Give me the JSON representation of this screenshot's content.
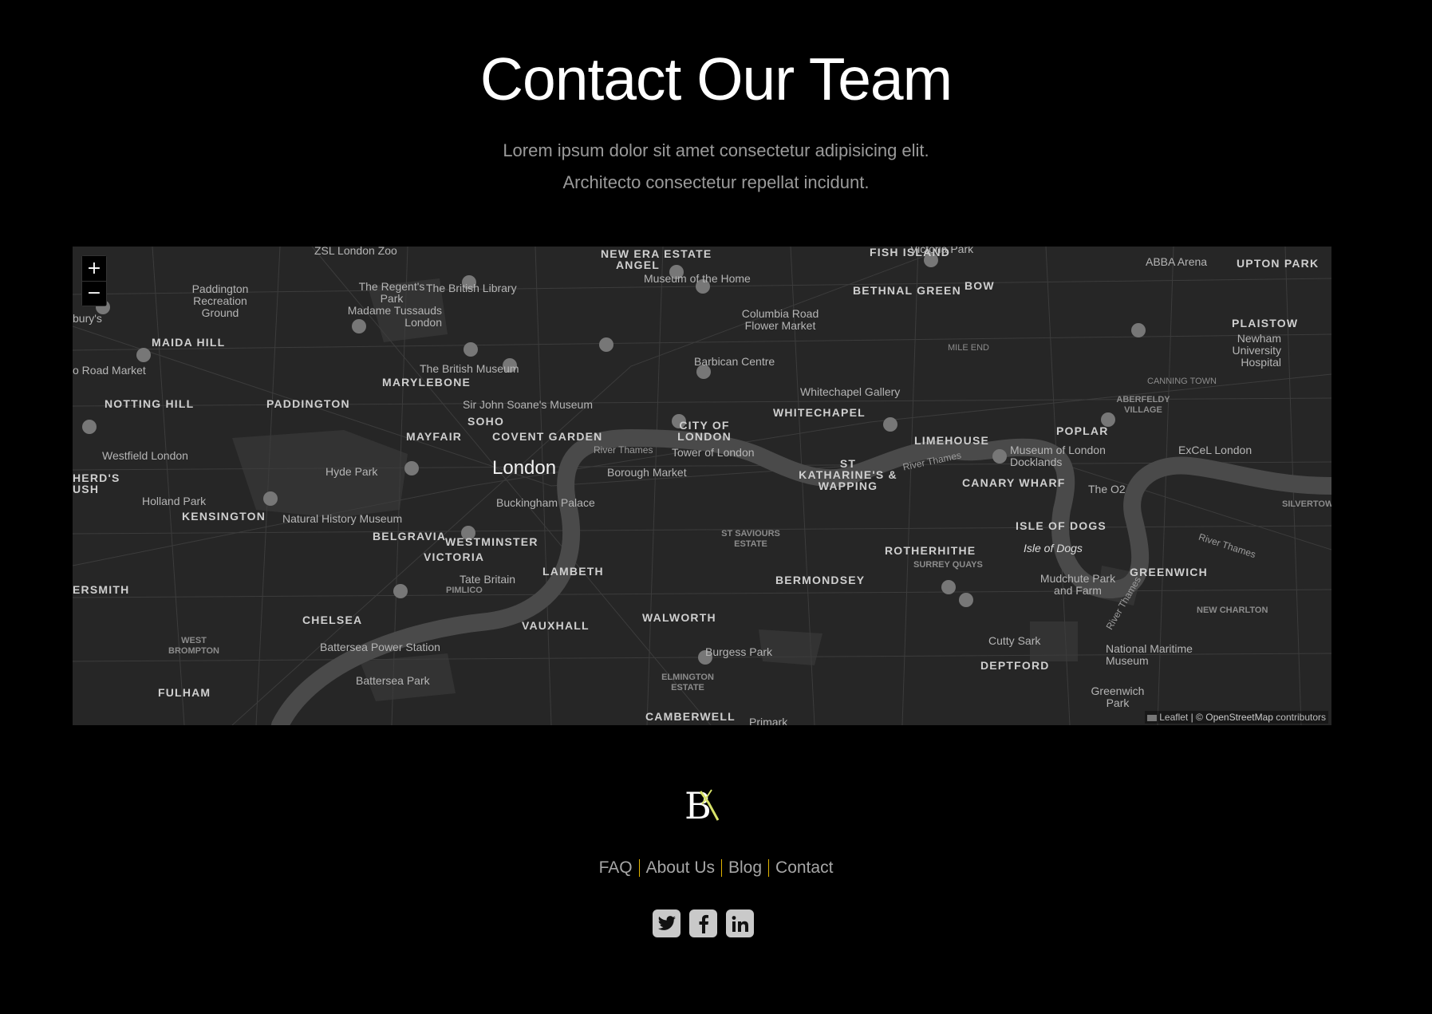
{
  "header": {
    "title": "Contact Our Team",
    "subtitle_line1": "Lorem ipsum dolor sit amet consectetur adipisicing elit.",
    "subtitle_line2": "Architecto consectetur repellat incidunt."
  },
  "map": {
    "zoom_in": "+",
    "zoom_out": "−",
    "attribution_leaflet": "Leaflet",
    "attribution_osm": "| © OpenStreetMap",
    "attribution_contrib": "contributors",
    "city_label": "London",
    "districts": [
      "NEW ERA ESTATE",
      "ANGEL",
      "FISH ISLAND",
      "UPTON PARK",
      "BETHNAL GREEN",
      "BOW",
      "PLAISTOW",
      "MAIDA HILL",
      "MILE END",
      "MARYLEBONE",
      "NOTTING HILL",
      "PADDINGTON",
      "CANNING TOWN",
      "SOHO",
      "MAYFAIR",
      "COVENT GARDEN",
      "CITY OF LONDON",
      "WHITECHAPEL",
      "ABERFELDY VILLAGE",
      "LIMEHOUSE",
      "POPLAR",
      "KENSINGTON",
      "ST KATHARINE'S & WAPPING",
      "CANARY WHARF",
      "BELGRAVIA",
      "WESTMINSTER",
      "VICTORIA",
      "ISLE OF DOGS",
      "ST SAVIOURS ESTATE",
      "ROTHERHITHE",
      "LAMBETH",
      "PIMLICO",
      "GREENWICH",
      "BERMONDSEY",
      "CHELSEA",
      "VAUXHALL",
      "WALWORTH",
      "NEW CHARLTON",
      "WEST BROMPTON",
      "FULHAM",
      "DEPTFORD",
      "ELMINGTON ESTATE",
      "CAMBERWELL",
      "ERSMITH",
      "HERD'S USH",
      "SILVERTOWN",
      "SURREY QUAYS"
    ],
    "pois": [
      "ZSL London Zoo",
      "Victoria Park",
      "ABBA Arena",
      "Museum of the Home",
      "Paddington Recreation Ground",
      "The Regent's Park",
      "The British Library",
      "Madame Tussauds London",
      "Columbia Road Flower Market",
      "Newham University Hospital",
      "The British Museum",
      "Barbican Centre",
      "Sir John Soane's Museum",
      "Whitechapel Gallery",
      "Westfield London",
      "Tower of London",
      "Museum of London Docklands",
      "ExCeL London",
      "Hyde Park",
      "Borough Market",
      "Buckingham Palace",
      "The O2",
      "Holland Park",
      "Natural History Museum",
      "Isle of Dogs",
      "Tate Britain",
      "Mudchute Park and Farm",
      "Battersea Power Station",
      "Cutty Sark",
      "National Maritime Museum",
      "Burgess Park",
      "Battersea Park",
      "Greenwich Park",
      "Primark",
      "o Road Market",
      "bury's"
    ],
    "rivers": [
      "River Thames",
      "River Thames",
      "River Thames",
      "River Thames"
    ]
  },
  "footer": {
    "logo_text": "BK",
    "nav": [
      "FAQ",
      "About Us",
      "Blog",
      "Contact"
    ],
    "social": [
      "twitter",
      "facebook",
      "linkedin"
    ]
  },
  "colors": {
    "background": "#000000",
    "map_water": "#4a4a4a",
    "map_land": "#262626",
    "separator": "#e2b400",
    "logo_accent": "#d7e26a"
  }
}
